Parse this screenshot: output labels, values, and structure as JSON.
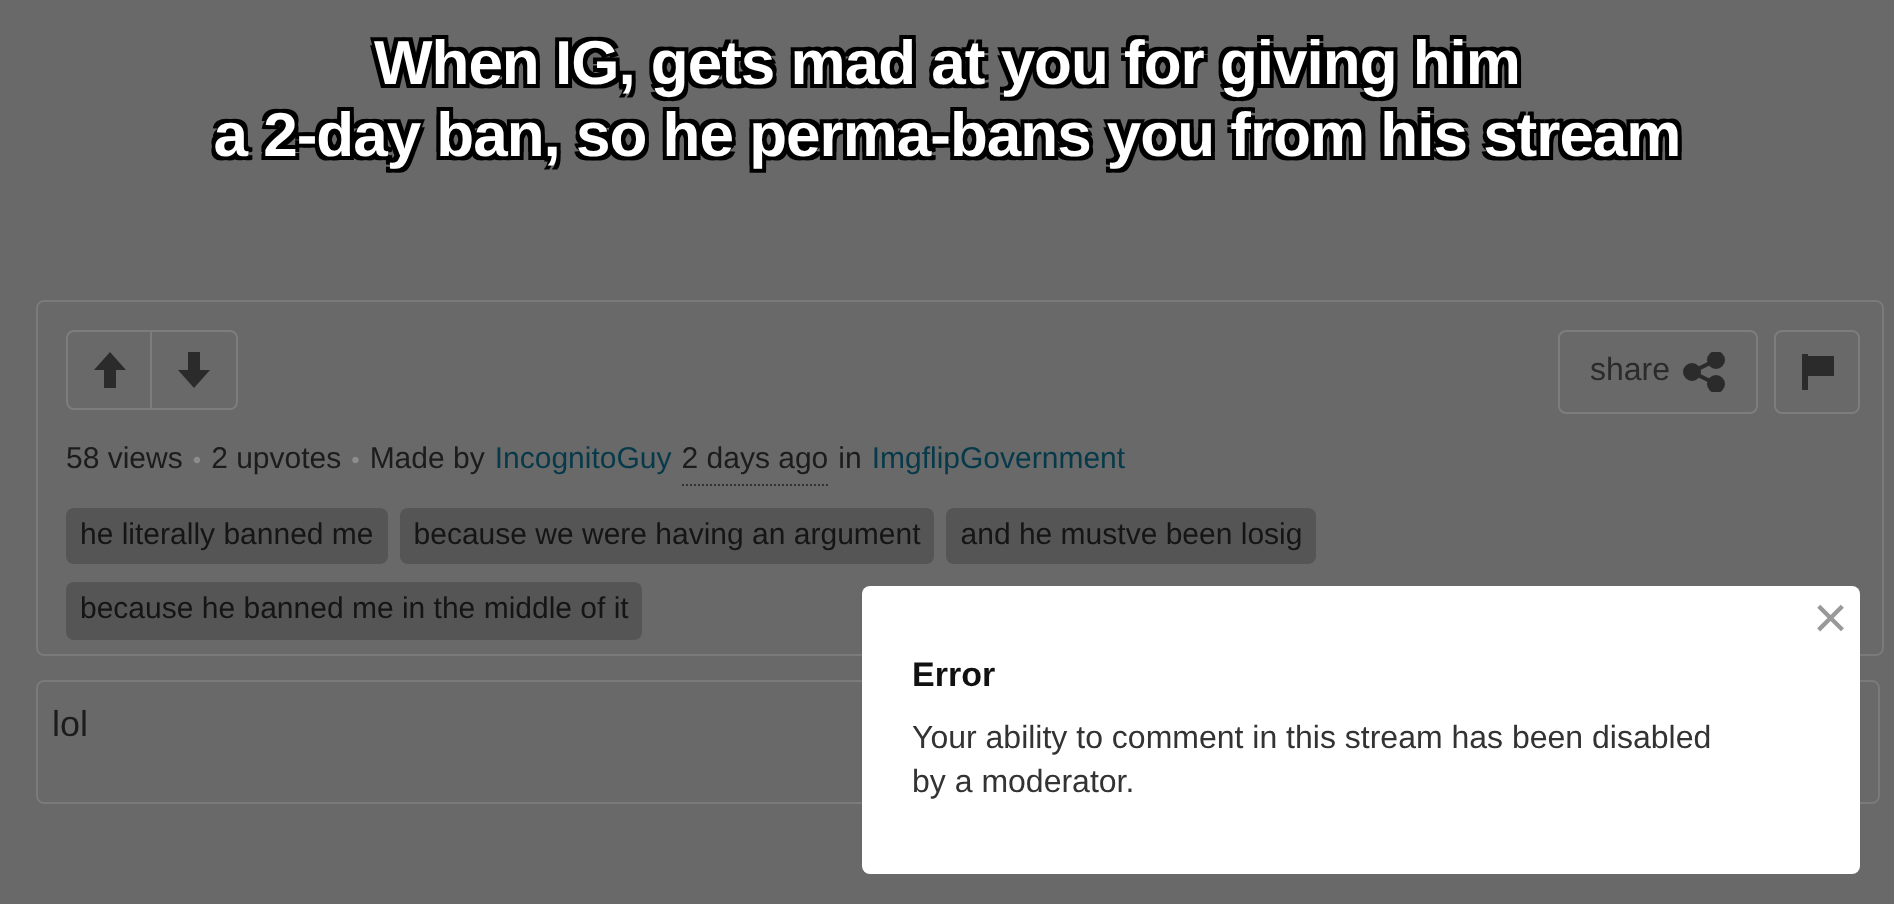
{
  "caption": [
    "When IG, gets mad at you for giving him",
    "a 2-day ban, so he perma-bans you from his stream"
  ],
  "post": {
    "share": "share",
    "meta": [
      {
        "kind": "text",
        "text": "58 views"
      },
      {
        "kind": "dot",
        "text": "•"
      },
      {
        "kind": "text",
        "text": "2 upvotes"
      },
      {
        "kind": "dot",
        "text": "•"
      },
      {
        "kind": "text",
        "text": "Made by"
      },
      {
        "kind": "link",
        "text": "IncognitoGuy"
      },
      {
        "kind": "time",
        "text": "2 days ago"
      },
      {
        "kind": "text",
        "text": "in"
      },
      {
        "kind": "link",
        "text": "ImgflipGovernment"
      }
    ],
    "tags": [
      "he literally banned me",
      "because we were having an argument",
      "and he mustve been losig",
      "because he banned me in the middle of it"
    ]
  },
  "comment_field": {
    "value": "lol"
  },
  "dialog": {
    "close": "×",
    "title": "Error",
    "message": "Your ability to comment in this stream has been disabled by a moderator."
  }
}
